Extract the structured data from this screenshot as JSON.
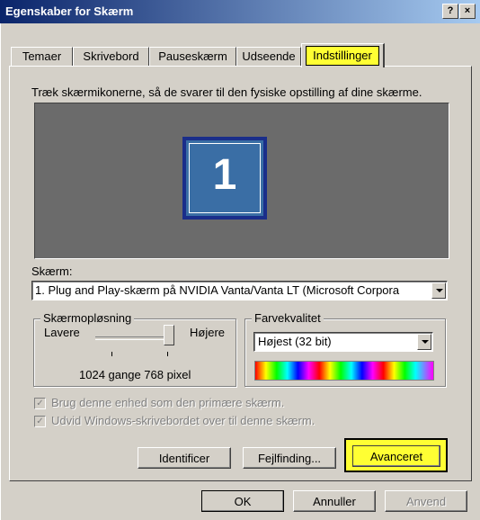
{
  "window": {
    "title": "Egenskaber for Skærm",
    "help_glyph": "?",
    "close_glyph": "×"
  },
  "tabs": [
    {
      "label": "Temaer",
      "active": false
    },
    {
      "label": "Skrivebord",
      "active": false
    },
    {
      "label": "Pauseskærm",
      "active": false
    },
    {
      "label": "Udseende",
      "active": false
    },
    {
      "label": "Indstillinger",
      "active": true
    }
  ],
  "instructions": "Træk skærmikonerne, så de svarer til den fysiske opstilling af dine skærme.",
  "monitor_number": "1",
  "display": {
    "label": "Skærm:",
    "value": "1. Plug and Play-skærm på NVIDIA Vanta/Vanta LT (Microsoft Corpora"
  },
  "resolution": {
    "legend": "Skærmopløsning",
    "less_label": "Lavere",
    "more_label": "Højere",
    "value_text": "1024 gange 768 pixel",
    "slider_position_fraction": 1.0
  },
  "color_quality": {
    "legend": "Farvekvalitet",
    "value": "Højest (32 bit)"
  },
  "checkboxes": [
    {
      "label": "Brug denne enhed som den primære skærm.",
      "checked": true,
      "enabled": false
    },
    {
      "label": "Udvid Windows-skrivebordet over til denne skærm.",
      "checked": true,
      "enabled": false
    }
  ],
  "panel_buttons": {
    "identify": "Identificer",
    "troubleshoot": "Fejlfinding...",
    "advanced": "Avanceret"
  },
  "dialog_buttons": {
    "ok": "OK",
    "cancel": "Annuller",
    "apply": "Anvend"
  },
  "colors": {
    "dialog_bg": "#d4d0c8",
    "titlebar_start": "#0a246a",
    "monitor_area": "#6b6b6b",
    "monitor_fill": "#3a6ea5",
    "highlight": "#ffff33"
  }
}
